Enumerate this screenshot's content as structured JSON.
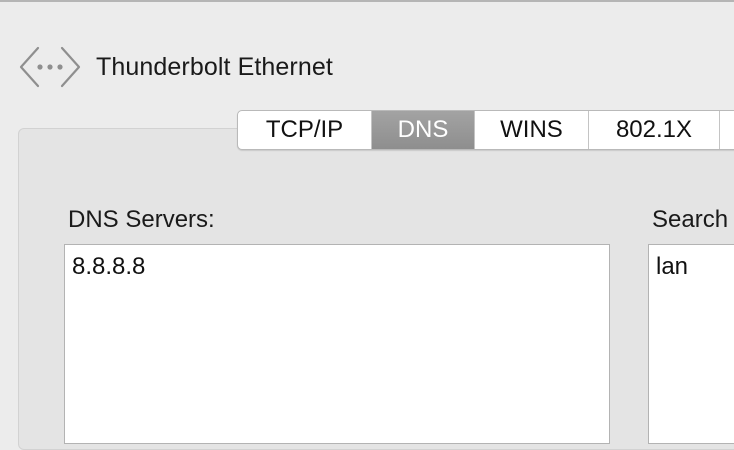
{
  "interface": {
    "icon": "network-interface-icon",
    "name": "Thunderbolt Ethernet"
  },
  "tabs": [
    {
      "label": "TCP/IP",
      "selected": false
    },
    {
      "label": "DNS",
      "selected": true
    },
    {
      "label": "WINS",
      "selected": false
    },
    {
      "label": "802.1X",
      "selected": false
    }
  ],
  "dns_servers": {
    "label": "DNS Servers:",
    "entries": [
      "8.8.8.8"
    ]
  },
  "search_domains": {
    "label": "Search",
    "entries": [
      "lan"
    ]
  },
  "colors": {
    "window_background": "#ececec",
    "selected_tab": "#999999"
  }
}
